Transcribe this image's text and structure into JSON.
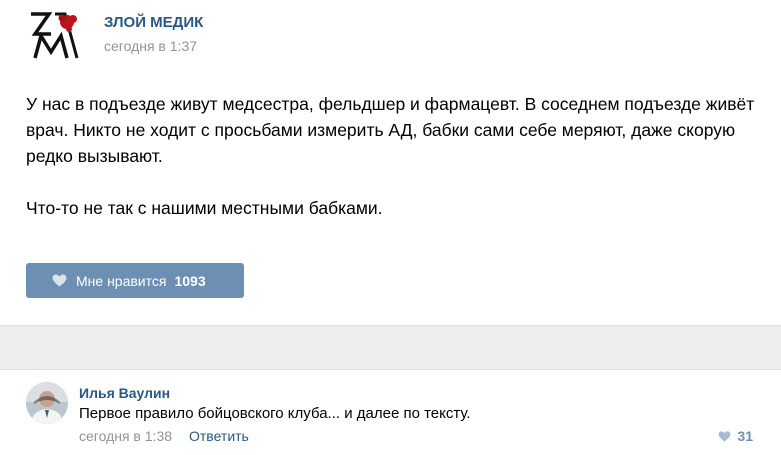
{
  "post": {
    "group_name": "ЗЛОЙ МЕДИК",
    "time": "сегодня в 1:37",
    "paragraphs": [
      "У нас в подъезде живут медсестра, фельдшер и фармацевт. В соседнем подъезде живёт врач. Никто не ходит с просьбами измерить АД, бабки сами себе меряют, даже скорую редко вызывают.",
      "Что-то не так с нашими местными бабками."
    ],
    "like_label": "Мне нравится",
    "like_count": "1093"
  },
  "comment": {
    "author": "Илья Ваулин",
    "text": "Первое правило бойцовского клуба... и далее по тексту.",
    "time": "сегодня в 1:38",
    "reply_label": "Ответить",
    "like_count": "31"
  },
  "icons": {
    "logo": "zm-logo-icon",
    "like": "heart-icon",
    "avatar": "user-avatar"
  },
  "colors": {
    "link": "#2a5885",
    "button": "#6d8fb3",
    "meta": "#939393",
    "separator": "#edeef0"
  }
}
